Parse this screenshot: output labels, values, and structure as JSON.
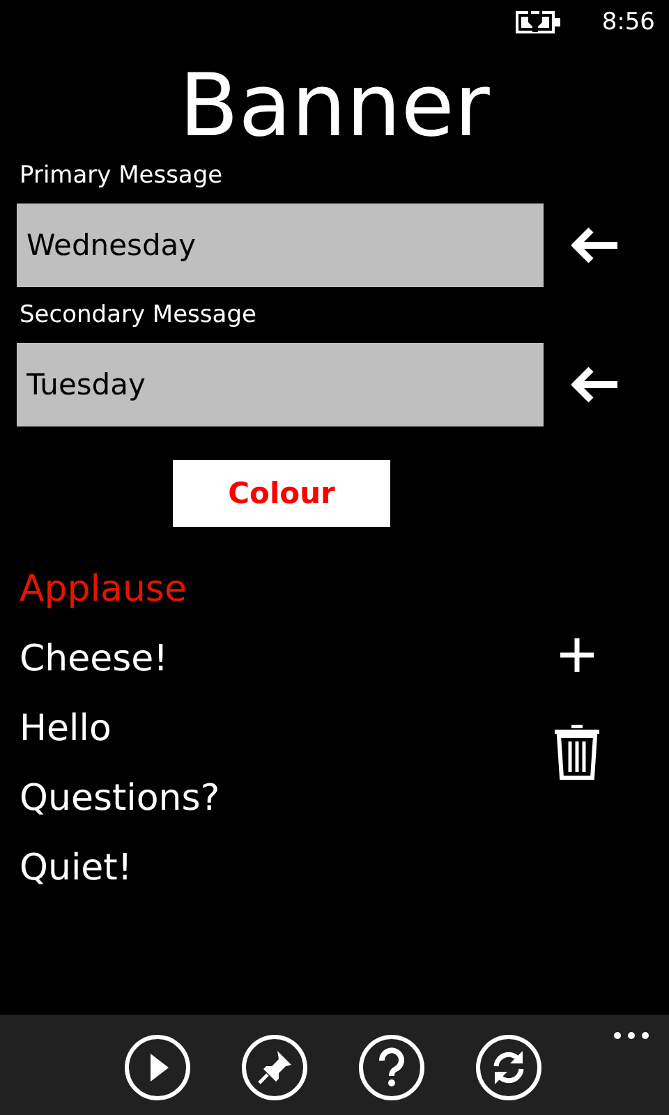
{
  "status_bar": {
    "time": "8:56"
  },
  "title": "Banner",
  "fields": [
    {
      "label": "Primary Message",
      "value": "Wednesday"
    },
    {
      "label": "Secondary Message",
      "value": "Tuesday"
    }
  ],
  "colour_button": {
    "label": "Colour",
    "color": "#ff0000"
  },
  "messages": [
    {
      "text": "Applause",
      "selected": true
    },
    {
      "text": "Cheese!",
      "selected": false
    },
    {
      "text": "Hello",
      "selected": false
    },
    {
      "text": "Questions?",
      "selected": false
    },
    {
      "text": "Quiet!",
      "selected": false
    }
  ],
  "app_bar": {
    "buttons": [
      {
        "kind": "play"
      },
      {
        "kind": "pin"
      },
      {
        "kind": "help"
      },
      {
        "kind": "refresh"
      }
    ]
  }
}
